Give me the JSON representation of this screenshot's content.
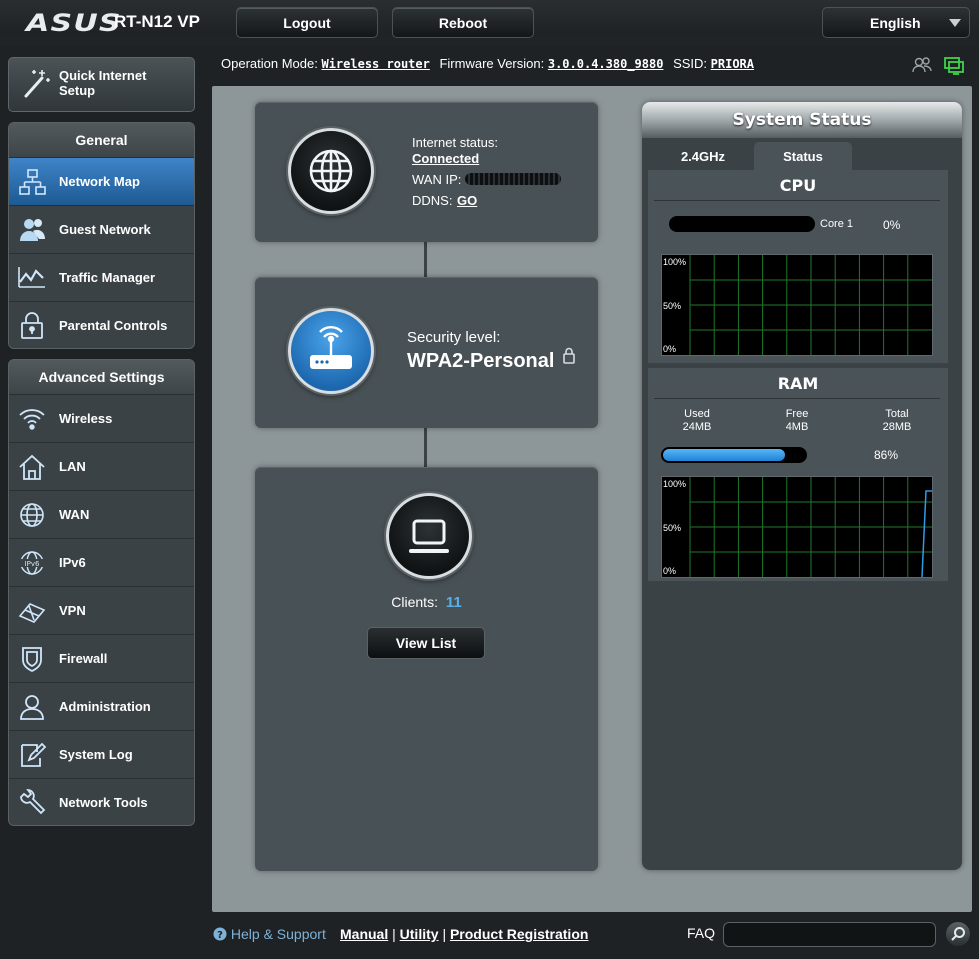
{
  "header": {
    "brand": "ASUS",
    "model": "RT-N12 VP",
    "logout_label": "Logout",
    "reboot_label": "Reboot",
    "language": "English"
  },
  "info": {
    "operation_mode_label": "Operation Mode:",
    "operation_mode": "Wireless router",
    "firmware_label": "Firmware Version:",
    "firmware": "3.0.0.4.380_9880",
    "ssid_label": "SSID:",
    "ssid": "PRIORA"
  },
  "sidebar": {
    "qis_label": "Quick Internet Setup",
    "general_title": "General",
    "general_items": [
      {
        "label": "Network Map",
        "icon": "network-map-icon"
      },
      {
        "label": "Guest Network",
        "icon": "guest-network-icon"
      },
      {
        "label": "Traffic Manager",
        "icon": "traffic-manager-icon"
      },
      {
        "label": "Parental Controls",
        "icon": "parental-controls-icon"
      }
    ],
    "advanced_title": "Advanced Settings",
    "advanced_items": [
      {
        "label": "Wireless",
        "icon": "wifi-icon"
      },
      {
        "label": "LAN",
        "icon": "home-icon"
      },
      {
        "label": "WAN",
        "icon": "globe-icon"
      },
      {
        "label": "IPv6",
        "icon": "ipv6-icon"
      },
      {
        "label": "VPN",
        "icon": "vpn-icon"
      },
      {
        "label": "Firewall",
        "icon": "shield-icon"
      },
      {
        "label": "Administration",
        "icon": "user-icon"
      },
      {
        "label": "System Log",
        "icon": "log-icon"
      },
      {
        "label": "Network Tools",
        "icon": "tools-icon"
      }
    ]
  },
  "internet": {
    "status_label": "Internet status:",
    "status": "Connected",
    "wan_ip_label": "WAN IP:",
    "ddns_label": "DDNS:",
    "ddns_link": "GO"
  },
  "router": {
    "security_label": "Security level:",
    "security": "WPA2-Personal"
  },
  "clients": {
    "label": "Clients:",
    "count": "11",
    "view_list_label": "View List"
  },
  "system_status": {
    "title": "System Status",
    "tab_24": "2.4GHz",
    "tab_status": "Status",
    "cpu_title": "CPU",
    "core_label": "Core 1",
    "core_percent": "0%",
    "core_value": 0,
    "ram_title": "RAM",
    "used_label": "Used",
    "used": "24MB",
    "free_label": "Free",
    "free": "4MB",
    "total_label": "Total",
    "total": "28MB",
    "ram_percent": "86%",
    "ram_value": 86,
    "graph_100": "100%",
    "graph_50": "50%",
    "graph_0": "0%"
  },
  "footer": {
    "help": "Help & Support",
    "manual": "Manual",
    "utility": "Utility",
    "registration": "Product Registration",
    "sep": "|",
    "faq": "FAQ"
  },
  "colors": {
    "accent_blue": "#2f9be8",
    "client_count": "#5ab0e8",
    "graph_grid": "#1f7a2a"
  }
}
